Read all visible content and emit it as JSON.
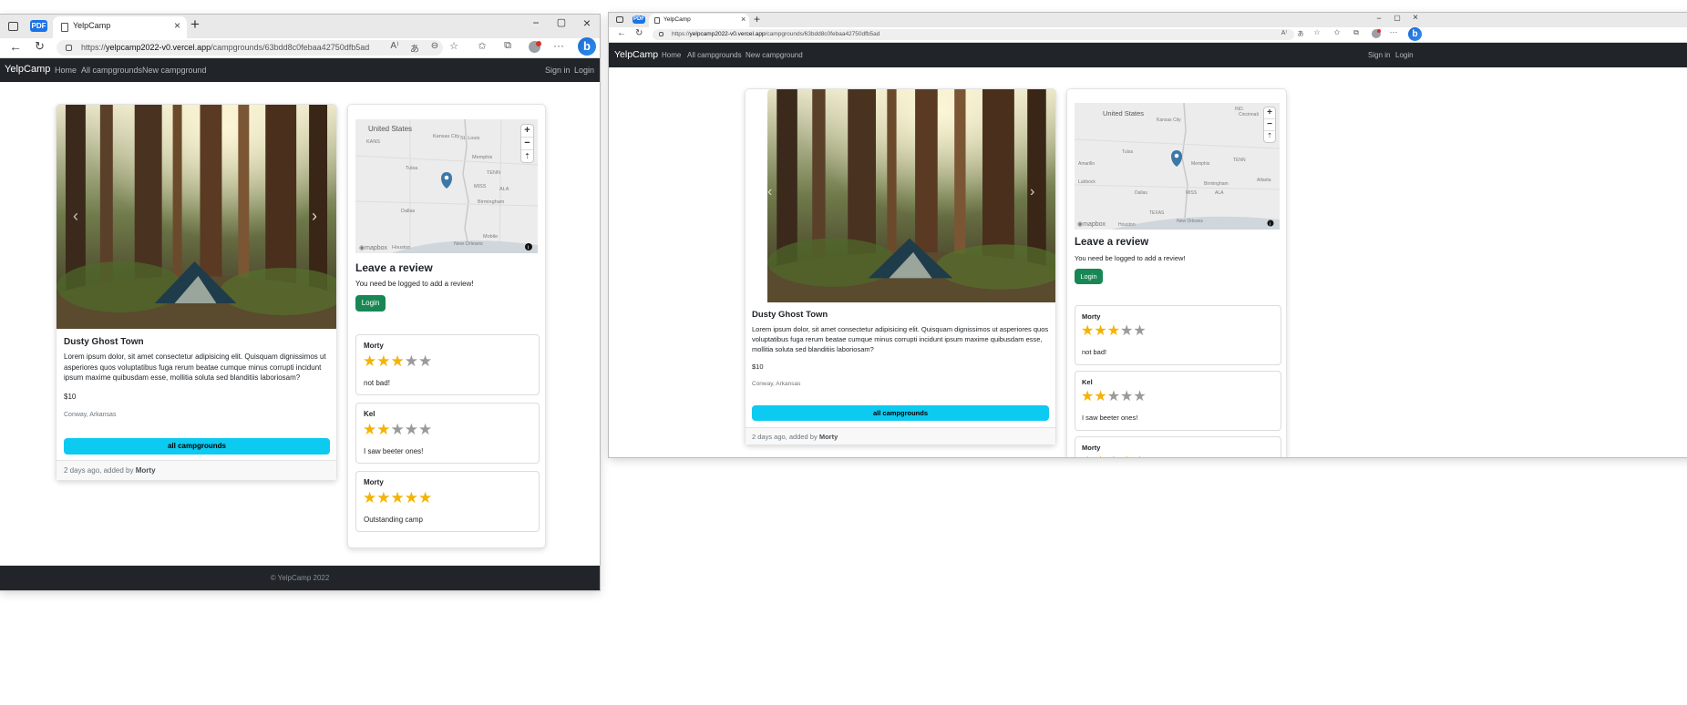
{
  "browser": {
    "pdf_badge": "PDF",
    "tab_title": "YelpCamp",
    "url_scheme": "https://",
    "url_host": "yelpcamp2022-v0.vercel.app",
    "url_path": "/campgrounds/63bdd8c0febaa42750dfb5ad",
    "bing_label": "b"
  },
  "site": {
    "brand": "YelpCamp",
    "nav": [
      "Home",
      "All campgrounds",
      "New campground"
    ],
    "nav_right": [
      "Sign in",
      "Login"
    ],
    "footer": "© YelpCamp 2022"
  },
  "campground": {
    "title": "Dusty Ghost Town",
    "description": "Lorem ipsum dolor, sit amet consectetur adipisicing elit. Quisquam dignissimos ut asperiores quos voluptatibus fuga rerum beatae cumque minus corrupti incidunt ipsum maxime quibusdam esse, mollitia soluta sed blanditiis laboriosam?",
    "price": "$10",
    "location": "Conway, Arkansas",
    "all_button": "all campgrounds",
    "footer_prefix": "2 days ago, added by",
    "author": "Morty"
  },
  "map": {
    "labels": [
      "United States",
      "Kansas City",
      "St. Louis",
      "Tulsa",
      "Memphis",
      "Dallas",
      "Birmingham",
      "Houston",
      "New Orleans",
      "Mobile",
      "KANS",
      "MO",
      "OKLA",
      "ARK",
      "MISS",
      "ALA",
      "TEXAS",
      "LA",
      "Amarillo",
      "Lubbock",
      "Cincinnati",
      "IND.",
      "TENN",
      "Atlanta"
    ],
    "attribution": "mapbox",
    "zoom_in": "+",
    "zoom_out": "−",
    "compass": "⇡",
    "info": "i"
  },
  "review": {
    "heading": "Leave a review",
    "note": "You need be logged to add a review!",
    "login_button": "Login"
  },
  "reviews": [
    {
      "author": "Morty",
      "rating": 3,
      "text": "not bad!"
    },
    {
      "author": "Kel",
      "rating": 2,
      "text": "I saw beeter ones!"
    },
    {
      "author": "Morty",
      "rating": 5,
      "text": "Outstanding camp"
    }
  ],
  "colors": {
    "navbar": "#212529",
    "info_button": "#0dcaf0",
    "success_button": "#198754",
    "star": "#f5b301"
  },
  "icons": [
    "sidebar-icon",
    "document-icon",
    "close-icon",
    "plus-icon",
    "minimize-icon",
    "maximize-icon",
    "back-arrow-icon",
    "refresh-icon",
    "lock-icon",
    "read-aloud-icon",
    "translate-icon",
    "zoom-icon",
    "favorite-add-icon",
    "favorites-icon",
    "collections-icon",
    "profile-icon",
    "more-icon",
    "bing-icon",
    "map-pin-icon",
    "carousel-prev-icon",
    "carousel-next-icon",
    "star-icon"
  ]
}
